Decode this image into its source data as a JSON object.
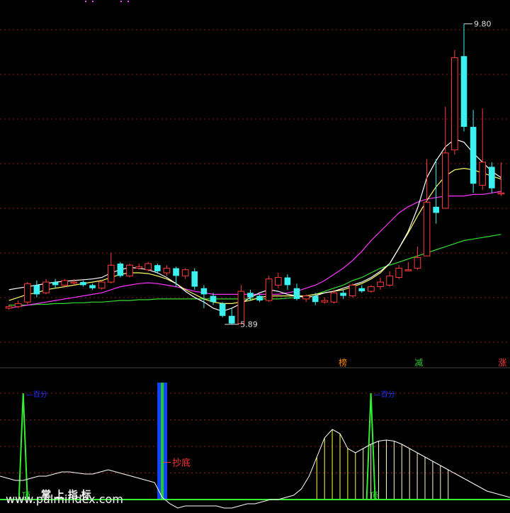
{
  "chart_data": [
    {
      "type": "candlestick",
      "colors": {
        "up": "#ff3b3b",
        "down": "#3cf0f0",
        "ma5": "#ffffff",
        "ma10": "#ffff66",
        "ma20": "#ff33ff",
        "ma60": "#33dd33"
      },
      "ylim": [
        5.5,
        10.0
      ],
      "annotations": {
        "high_label": "9.80",
        "low_label": "5.89"
      },
      "markers": [
        {
          "text": "榜",
          "color": "#ff8800",
          "index": 44
        },
        {
          "text": "减",
          "color": "#33cc33",
          "index": 54
        },
        {
          "text": "涨",
          "color": "#ff3333",
          "index": 65
        }
      ],
      "candles": [
        [
          6.1,
          6.12,
          6.08,
          6.14
        ],
        [
          6.12,
          6.16,
          6.1,
          6.2
        ],
        [
          6.18,
          6.42,
          6.15,
          6.44
        ],
        [
          6.4,
          6.28,
          6.24,
          6.46
        ],
        [
          6.3,
          6.44,
          6.28,
          6.48
        ],
        [
          6.44,
          6.4,
          6.36,
          6.48
        ],
        [
          6.4,
          6.46,
          6.38,
          6.48
        ],
        [
          6.44,
          6.44,
          6.4,
          6.48
        ],
        [
          6.44,
          6.4,
          6.38,
          6.46
        ],
        [
          6.4,
          6.36,
          6.34,
          6.42
        ],
        [
          6.36,
          6.44,
          6.34,
          6.46
        ],
        [
          6.44,
          6.66,
          6.42,
          6.82
        ],
        [
          6.68,
          6.52,
          6.5,
          6.7
        ],
        [
          6.52,
          6.66,
          6.5,
          6.68
        ],
        [
          6.62,
          6.64,
          6.6,
          6.68
        ],
        [
          6.6,
          6.68,
          6.58,
          6.7
        ],
        [
          6.66,
          6.58,
          6.55,
          6.68
        ],
        [
          6.56,
          6.62,
          6.52,
          6.66
        ],
        [
          6.62,
          6.52,
          6.38,
          6.64
        ],
        [
          6.52,
          6.6,
          6.48,
          6.62
        ],
        [
          6.58,
          6.38,
          6.34,
          6.62
        ],
        [
          6.36,
          6.28,
          6.1,
          6.4
        ],
        [
          6.26,
          6.18,
          6.14,
          6.3
        ],
        [
          6.16,
          6.0,
          5.98,
          6.18
        ],
        [
          6.0,
          5.9,
          5.89,
          6.1
        ],
        [
          5.9,
          6.32,
          5.89,
          6.4
        ],
        [
          6.3,
          6.24,
          6.2,
          6.34
        ],
        [
          6.26,
          6.2,
          6.18,
          6.28
        ],
        [
          6.2,
          6.48,
          6.18,
          6.52
        ],
        [
          6.4,
          6.5,
          6.36,
          6.56
        ],
        [
          6.5,
          6.4,
          6.34,
          6.54
        ],
        [
          6.36,
          6.22,
          6.2,
          6.42
        ],
        [
          6.22,
          6.26,
          6.18,
          6.28
        ],
        [
          6.26,
          6.18,
          6.14,
          6.3
        ],
        [
          6.18,
          6.2,
          6.16,
          6.24
        ],
        [
          6.18,
          6.3,
          6.16,
          6.34
        ],
        [
          6.3,
          6.26,
          6.22,
          6.34
        ],
        [
          6.26,
          6.4,
          6.24,
          6.42
        ],
        [
          6.36,
          6.32,
          6.3,
          6.4
        ],
        [
          6.32,
          6.38,
          6.3,
          6.4
        ],
        [
          6.38,
          6.44,
          6.34,
          6.5
        ],
        [
          6.4,
          6.52,
          6.38,
          6.58
        ],
        [
          6.5,
          6.62,
          6.48,
          6.66
        ],
        [
          6.6,
          6.6,
          6.58,
          6.7
        ],
        [
          6.62,
          6.76,
          6.6,
          6.9
        ],
        [
          6.78,
          7.48,
          6.78,
          8.04
        ],
        [
          7.42,
          7.34,
          7.2,
          8.04
        ],
        [
          7.4,
          8.12,
          7.4,
          8.72
        ],
        [
          8.16,
          9.36,
          8.1,
          9.46
        ],
        [
          9.38,
          8.46,
          8.4,
          9.8
        ],
        [
          8.46,
          7.72,
          7.6,
          8.68
        ],
        [
          7.7,
          8.0,
          7.64,
          8.7
        ],
        [
          7.94,
          7.66,
          7.6,
          8.0
        ],
        [
          7.6,
          7.6,
          7.56,
          8.0
        ]
      ],
      "ma5": [
        6.34,
        6.36,
        6.38,
        6.4,
        6.42,
        6.44,
        6.45,
        6.46,
        6.47,
        6.48,
        6.5,
        6.56,
        6.6,
        6.63,
        6.62,
        6.6,
        6.56,
        6.5,
        6.42,
        6.32,
        6.24,
        6.18,
        6.1,
        6.06,
        6.1,
        6.16,
        6.24,
        6.3,
        6.34,
        6.32,
        6.28,
        6.26,
        6.24,
        6.26,
        6.3,
        6.32,
        6.36,
        6.4,
        6.44,
        6.5,
        6.58,
        6.68,
        6.88,
        7.1,
        7.4,
        7.8,
        8.02,
        8.2,
        8.3,
        8.26,
        8.12,
        8.0,
        7.88,
        7.8
      ],
      "ma10": [
        6.2,
        6.24,
        6.28,
        6.3,
        6.34,
        6.36,
        6.38,
        6.4,
        6.42,
        6.44,
        6.46,
        6.5,
        6.54,
        6.56,
        6.56,
        6.55,
        6.52,
        6.48,
        6.42,
        6.34,
        6.28,
        6.22,
        6.18,
        6.16,
        6.16,
        6.18,
        6.2,
        6.24,
        6.26,
        6.26,
        6.26,
        6.26,
        6.26,
        6.28,
        6.3,
        6.32,
        6.34,
        6.38,
        6.42,
        6.48,
        6.56,
        6.68,
        6.88,
        7.08,
        7.3,
        7.5,
        7.68,
        7.82,
        7.9,
        7.92,
        7.9,
        7.86,
        7.82,
        7.78
      ],
      "ma20": [
        6.1,
        6.12,
        6.14,
        6.16,
        6.18,
        6.2,
        6.22,
        6.24,
        6.26,
        6.28,
        6.3,
        6.34,
        6.38,
        6.4,
        6.42,
        6.43,
        6.42,
        6.4,
        6.38,
        6.35,
        6.32,
        6.3,
        6.28,
        6.28,
        6.28,
        6.28,
        6.28,
        6.28,
        6.28,
        6.28,
        6.3,
        6.32,
        6.36,
        6.4,
        6.46,
        6.54,
        6.62,
        6.72,
        6.84,
        6.98,
        7.1,
        7.22,
        7.34,
        7.42,
        7.48,
        7.52,
        7.54,
        7.56,
        7.56,
        7.56,
        7.58,
        7.58,
        7.6,
        7.62
      ],
      "ma60": [
        6.14,
        6.14,
        6.14,
        6.15,
        6.15,
        6.16,
        6.16,
        6.17,
        6.17,
        6.18,
        6.18,
        6.19,
        6.2,
        6.2,
        6.21,
        6.21,
        6.22,
        6.22,
        6.22,
        6.22,
        6.22,
        6.22,
        6.22,
        6.22,
        6.22,
        6.22,
        6.22,
        6.22,
        6.22,
        6.22,
        6.23,
        6.24,
        6.26,
        6.28,
        6.32,
        6.36,
        6.4,
        6.46,
        6.5,
        6.56,
        6.62,
        6.66,
        6.7,
        6.74,
        6.78,
        6.82,
        6.86,
        6.9,
        6.94,
        6.98,
        7.0,
        7.02,
        7.04,
        7.06
      ]
    },
    {
      "type": "line",
      "ylim": [
        -10,
        110
      ],
      "labels": {
        "top_label": "—百分",
        "bottom_label": "顶",
        "signal_label": "抄底",
        "brand_text": "掌 上 指 标"
      },
      "spikes": [
        {
          "index": 3,
          "value": 100,
          "label": "百分"
        },
        {
          "index": 48,
          "value": 100,
          "label": "百分"
        }
      ],
      "bottom_band_index": 21,
      "line": [
        22,
        20,
        18,
        18,
        20,
        22,
        22,
        24,
        26,
        26,
        25,
        24,
        24,
        26,
        28,
        26,
        24,
        22,
        20,
        18,
        16,
        2,
        -4,
        -8,
        -6,
        -6,
        -6,
        -6,
        -6,
        -8,
        -8,
        -6,
        -4,
        -4,
        -2,
        0,
        0,
        2,
        4,
        10,
        22,
        40,
        58,
        66,
        62,
        48,
        44,
        48,
        52,
        55,
        56,
        55,
        52,
        48,
        44,
        40,
        36,
        32,
        28,
        24,
        20,
        16,
        12,
        8,
        6,
        4,
        2
      ]
    },
    {
      "type": "text",
      "watermark": "www.palmindex.com"
    }
  ]
}
